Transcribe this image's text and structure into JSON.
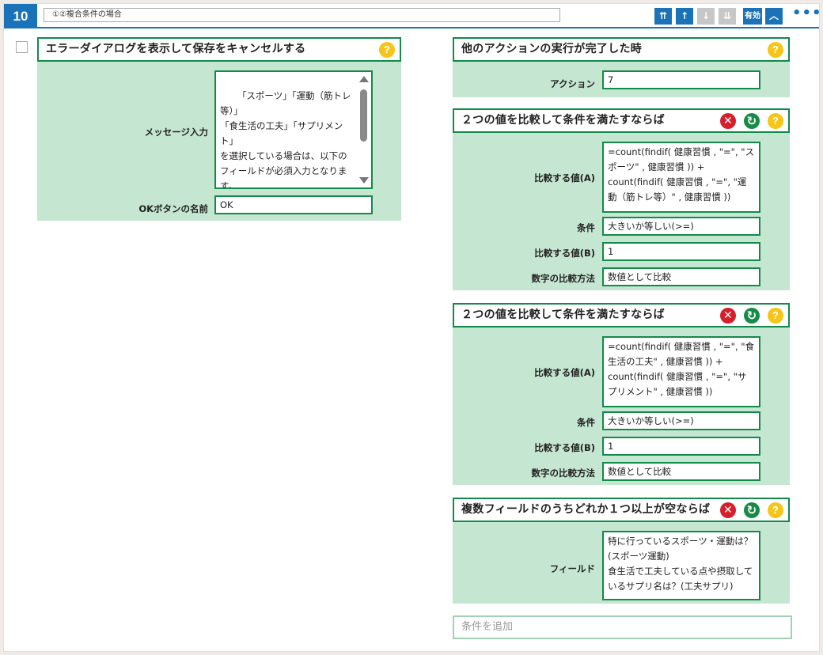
{
  "header": {
    "number": "10",
    "title": "①②複合条件の場合",
    "btn_top": "⇈",
    "btn_up": "↑",
    "btn_down": "↓",
    "btn_bottom": "⇊",
    "enabled_label": "有効",
    "collapse_glyph": "︿",
    "more_glyph": "•••"
  },
  "actions": [
    {
      "title": "エラーダイアログを表示して保存をキャンセルする",
      "message_label": "メッセージ入力",
      "message_text": "「スポーツ」「運動（筋トレ等）」\n「食生活の工夫」「サプリメント」\nを選択している場合は、以下のフィールドが必須入力となります。",
      "ok_label": "OKボタンの名前",
      "ok_value": "OK"
    }
  ],
  "conditions": [
    {
      "title": "他のアクションの実行が完了した時",
      "fields": [
        {
          "label": "アクション",
          "value": "7"
        }
      ]
    },
    {
      "title": "２つの値を比較して条件を満たすならば",
      "fields": [
        {
          "label": "比較する値(A)",
          "value": "=count(findif( 健康習慣 , \"=\", \"スポーツ\" , 健康習慣 )) + count(findif( 健康習慣 , \"=\", \"運動（筋トレ等）\" , 健康習慣 ))"
        },
        {
          "label": "条件",
          "value": "大きいか等しい(>=)"
        },
        {
          "label": "比較する値(B)",
          "value": "1"
        },
        {
          "label": "数字の比較方法",
          "value": "数値として比較"
        }
      ]
    },
    {
      "title": "２つの値を比較して条件を満たすならば",
      "fields": [
        {
          "label": "比較する値(A)",
          "value": "=count(findif( 健康習慣 , \"=\", \"食生活の工夫\" , 健康習慣 )) + count(findif( 健康習慣 , \"=\", \"サプリメント\" , 健康習慣 ))"
        },
        {
          "label": "条件",
          "value": "大きいか等しい(>=)"
        },
        {
          "label": "比較する値(B)",
          "value": "1"
        },
        {
          "label": "数字の比較方法",
          "value": "数値として比較"
        }
      ]
    },
    {
      "title": "複数フィールドのうちどれか１つ以上が空ならば",
      "fields": [
        {
          "label": "フィールド",
          "value": "特に行っているスポーツ・運動は？(スポーツ運動)\n食生活で工夫している点や摂取しているサプリ名は？(工夫サプリ)"
        }
      ]
    }
  ],
  "add_condition_placeholder": "条件を追加",
  "icons": {
    "help": "help-icon",
    "delete": "delete-icon",
    "refresh": "refresh-icon"
  },
  "colors": {
    "primary": "#1a73b8",
    "section_border": "#138a4a",
    "section_bg": "#c5e6d1",
    "help": "#f5c518",
    "delete": "#d61f2d",
    "refresh": "#178c45"
  }
}
